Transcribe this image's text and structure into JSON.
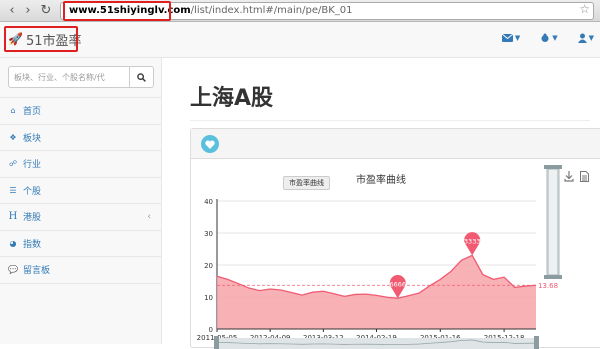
{
  "browser": {
    "url_host": "www.51shiyinglv.com",
    "url_path": "/list/index.html#/main/pe/BK_01"
  },
  "navbar": {
    "brand": "51市盈率",
    "icons": [
      "envelope-icon",
      "bug-icon",
      "user-icon"
    ]
  },
  "sidebar": {
    "search_placeholder": "板块、行业、个股名称/代",
    "items": [
      {
        "label": "首页",
        "icon": "home-icon"
      },
      {
        "label": "板块",
        "icon": "cubes-icon"
      },
      {
        "label": "行业",
        "icon": "sitemap-icon"
      },
      {
        "label": "个股",
        "icon": "list-icon"
      },
      {
        "label": "港股",
        "icon": "h-icon",
        "has_arrow": true
      },
      {
        "label": "指数",
        "icon": "dashboard-icon"
      },
      {
        "label": "留言板",
        "icon": "comments-icon"
      }
    ]
  },
  "main": {
    "title": "上海A股"
  },
  "colors": {
    "accent": "#337ab7",
    "series": "#f05b72",
    "area": "#f7a3a8",
    "datazoom": "#8a9ca0"
  },
  "chart_data": {
    "type": "area",
    "title": "市盈率曲线",
    "legend": [
      "市盈率曲线"
    ],
    "ylim": [
      0,
      40
    ],
    "yticks": [
      0,
      10,
      20,
      30,
      40
    ],
    "x_ticks": [
      "2011-05-05",
      "2012-04-09",
      "2013-03-12",
      "2014-02-19",
      "2015-01-16",
      "2015-12-18"
    ],
    "series": [
      {
        "name": "市盈率曲线",
        "x": [
          "2011-05-05",
          "2011-07",
          "2011-09",
          "2011-11",
          "2012-01",
          "2012-04-09",
          "2012-06",
          "2012-08",
          "2012-10",
          "2012-12",
          "2013-03-12",
          "2013-05",
          "2013-07",
          "2013-09",
          "2013-11",
          "2014-02-19",
          "2014-04",
          "2014-06",
          "2014-08",
          "2014-10",
          "2014-12",
          "2015-01-16",
          "2015-03",
          "2015-05",
          "2015-06",
          "2015-08",
          "2015-10",
          "2015-12-18",
          "2016-02",
          "2016-04",
          "2016-05"
        ],
        "values": [
          16.5,
          15.5,
          14.2,
          12.8,
          12.0,
          12.5,
          12.2,
          11.4,
          10.6,
          11.5,
          11.8,
          11.0,
          10.2,
          10.8,
          10.9,
          10.5,
          9.9,
          9.6,
          10.4,
          11.2,
          13.5,
          15.5,
          18.0,
          21.5,
          23.0,
          17.0,
          15.5,
          16.2,
          13.0,
          13.4,
          13.68
        ]
      }
    ],
    "annotations": [
      {
        "label": "6666",
        "x": "2014-06",
        "value": 9.6
      },
      {
        "label": "3333",
        "x": "2015-06",
        "value": 23.0
      }
    ],
    "markline": {
      "value": 13.68,
      "label": "13.68"
    }
  }
}
